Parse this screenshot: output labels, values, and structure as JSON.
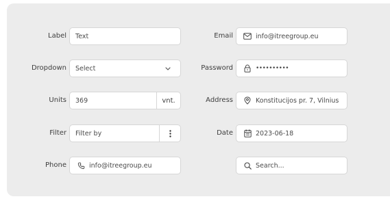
{
  "form": {
    "left": [
      {
        "label": "Label",
        "value": "Text",
        "kind": "text"
      },
      {
        "label": "Dropdown",
        "value": "Select",
        "kind": "select"
      },
      {
        "label": "Units",
        "value": "369",
        "suffix": "vnt.",
        "kind": "units"
      },
      {
        "label": "Filter",
        "value": "Filter by",
        "kind": "filter"
      },
      {
        "label": "Phone",
        "value": "info@itreegroup.eu",
        "icon": "phone-icon",
        "kind": "icon"
      }
    ],
    "right": [
      {
        "label": "Email",
        "value": "info@itreegroup.eu",
        "icon": "mail-icon",
        "kind": "icon"
      },
      {
        "label": "Password",
        "value": "••••••••••",
        "icon": "lock-icon",
        "kind": "icon"
      },
      {
        "label": "Address",
        "value": "Konstitucijos pr. 7, Vilnius",
        "icon": "location-pin-icon",
        "kind": "icon"
      },
      {
        "label": "Date",
        "value": "2023-06-18",
        "icon": "calendar-icon",
        "kind": "icon"
      },
      {
        "label": "",
        "value": "Search...",
        "icon": "search-icon",
        "kind": "icon"
      }
    ]
  },
  "colors": {
    "panel_bg": "#ececec",
    "field_bg": "#ffffff",
    "field_border": "#d6d6d6",
    "text": "#3d3d3d"
  }
}
